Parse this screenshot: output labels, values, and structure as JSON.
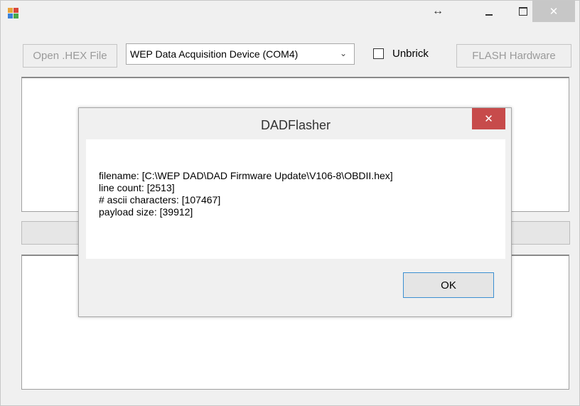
{
  "titlebar": {
    "icons": {
      "app": "app-icon",
      "resize": "left-right-arrow-icon",
      "minimize": "minimize-icon",
      "maximize": "maximize-icon",
      "close": "close-icon"
    },
    "resize_glyph": "↔",
    "close_glyph": "✕"
  },
  "toolbar": {
    "open_label": "Open .HEX File",
    "device_selected": "WEP Data Acquisition Device (COM4)",
    "unbrick_label": "Unbrick",
    "unbrick_checked": false,
    "flash_label": "FLASH Hardware"
  },
  "dialog": {
    "title": "DADFlasher",
    "close_glyph": "✕",
    "lines": [
      "filename: [C:\\WEP DAD\\DAD Firmware Update\\V106-8\\OBDII.hex]",
      "line count: [2513]",
      "# ascii characters: [107467]",
      "payload size: [39912]"
    ],
    "ok_label": "OK"
  },
  "colors": {
    "window_bg": "#f0f0f0",
    "close_active": "#c74b4b",
    "close_inactive": "#c7c7c7",
    "focus_border": "#3b8fd1"
  }
}
